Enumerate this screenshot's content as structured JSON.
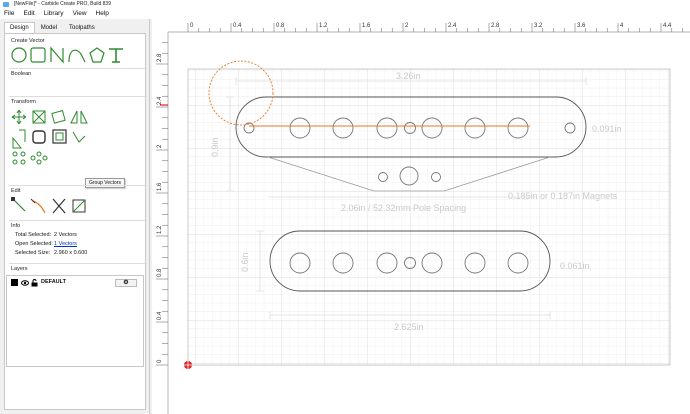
{
  "window": {
    "title": "[NewFile]* - Carbide Create PRO, Build 839"
  },
  "menu": [
    "File",
    "Edit",
    "Library",
    "View",
    "Help"
  ],
  "tabs": [
    "Design",
    "Model",
    "Toolpaths"
  ],
  "create_vector": {
    "label": "Create Vector",
    "tools": [
      "circle-icon",
      "rectangle-icon",
      "polyline-icon",
      "curve-icon",
      "polygon-icon",
      "text-icon"
    ]
  },
  "boolean": {
    "label": "Boolean"
  },
  "transform": {
    "label": "Transform",
    "tooltip": "Group Vectors"
  },
  "edit": {
    "label": "Edit"
  },
  "info": {
    "label": "Info",
    "total_selected_label": "Total Selected:",
    "total_selected_value": "2 Vectors",
    "open_selected_label": "Open Selected:",
    "open_selected_value": "1 Vectors",
    "selected_size_label": "Selected Size:",
    "selected_size_value": "2.960 x 0.600"
  },
  "layers": {
    "label": "Layers",
    "items": [
      {
        "name": "DEFAULT",
        "color": "#000000"
      }
    ]
  },
  "ruler": {
    "top_ticks": [
      "0",
      "0.4",
      "0.8",
      "1.2",
      "1.6",
      "2",
      "2.4",
      "2.8",
      "3.2",
      "3.6",
      "4",
      "4.4"
    ],
    "left_ticks": [
      "2.8",
      "2.4",
      "2",
      "1.6",
      "1.2",
      "0.8",
      "0.4",
      "0"
    ]
  },
  "annotations": {
    "width_top": "3.26in",
    "hole_right": "0.091in",
    "height_left": "0.9in",
    "magnets": "0.185in or 0.187in Magnets",
    "pole_spacing": "2.06in / 52.32mm Pole Spacing",
    "height_left_bottom": "0.6in",
    "hole_right_bottom": "0.061in",
    "width_bottom": "2.625in"
  },
  "colors": {
    "selection": "#e87722",
    "accent_green": "#2e8b2e",
    "grid": "#e6e6e6"
  }
}
